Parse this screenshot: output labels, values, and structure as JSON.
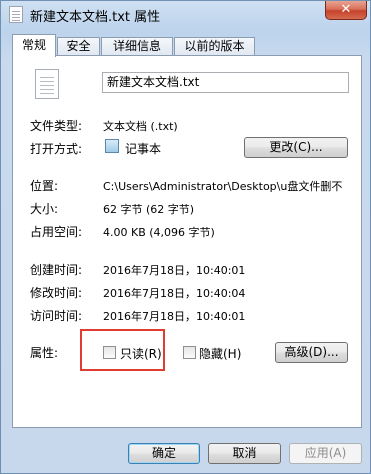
{
  "window": {
    "title": "新建文本文档.txt 属性",
    "close_label": "✕"
  },
  "tabs": [
    "常规",
    "安全",
    "详细信息",
    "以前的版本"
  ],
  "general": {
    "filename": "新建文本文档.txt",
    "file_type_label": "文件类型:",
    "file_type_value": "文本文档 (.txt)",
    "open_with_label": "打开方式:",
    "open_with_value": "记事本",
    "change_button": "更改(C)...",
    "location_label": "位置:",
    "location_value": "C:\\Users\\Administrator\\Desktop\\u盘文件删不",
    "size_label": "大小:",
    "size_value": "62 字节 (62 字节)",
    "size_on_disk_label": "占用空间:",
    "size_on_disk_value": "4.00 KB (4,096 字节)",
    "created_label": "创建时间:",
    "created_value": "2016年7月18日，10:40:01",
    "modified_label": "修改时间:",
    "modified_value": "2016年7月18日，10:40:04",
    "accessed_label": "访问时间:",
    "accessed_value": "2016年7月18日，10:40:01",
    "attributes_label": "属性:",
    "readonly_label": "只读(R)",
    "readonly_checked": false,
    "hidden_label": "隐藏(H)",
    "hidden_checked": false,
    "advanced_button": "高级(D)..."
  },
  "footer": {
    "ok": "确定",
    "cancel": "取消",
    "apply": "应用(A)"
  },
  "colors": {
    "highlight_box": "#e03c31",
    "close_button": "#c4422a"
  }
}
